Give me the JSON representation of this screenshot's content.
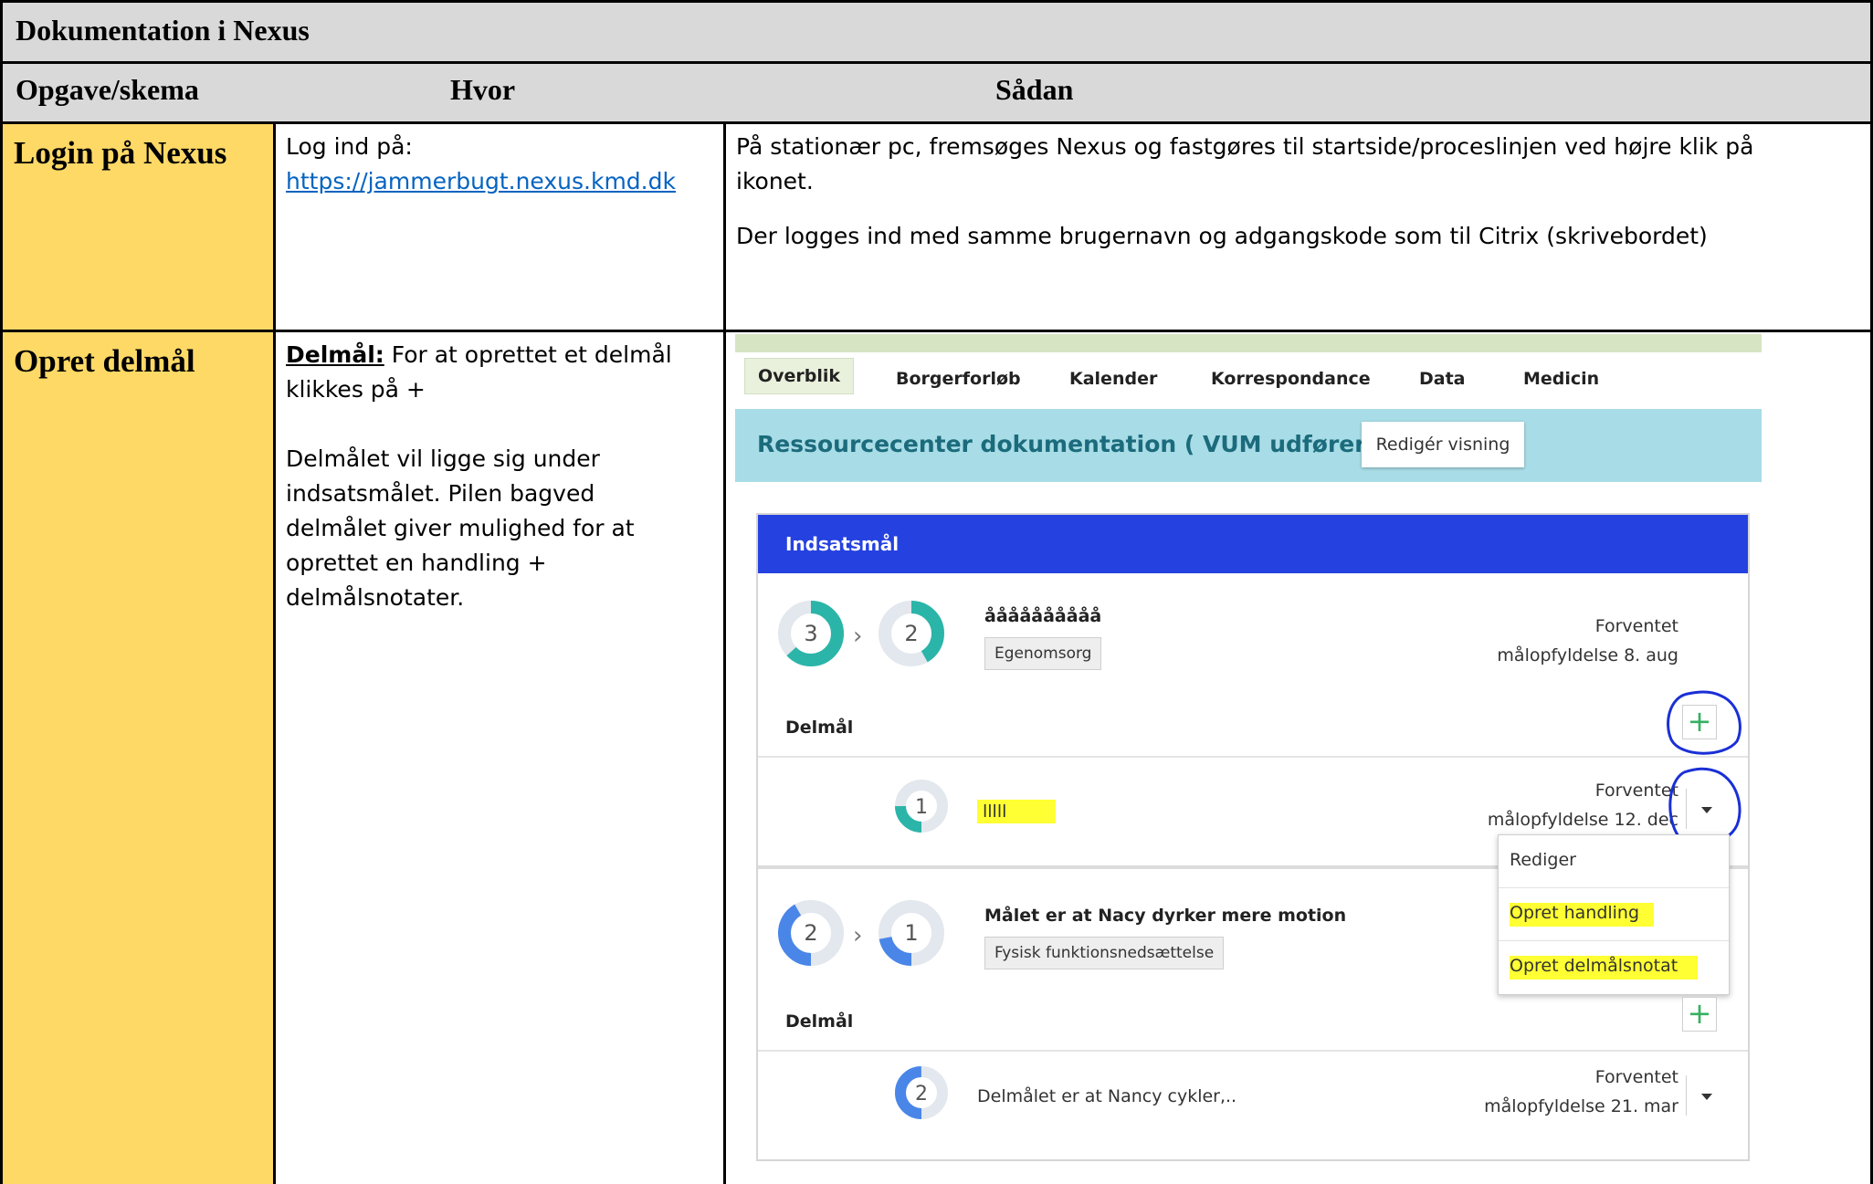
{
  "doc": {
    "title": "Dokumentation i Nexus",
    "headers": {
      "col1": "Opgave/skema",
      "col2": "Hvor",
      "col3": "Sådan"
    },
    "rows": [
      {
        "task": "Login på Nexus",
        "hvor_line1": "Log ind på:",
        "hvor_link": "https://jammerbugt.nexus.kmd.dk",
        "sadan_p1": "På stationær pc, fremsøges Nexus og fastgøres til startside/proceslinjen ved højre klik på ikonet.",
        "sadan_p2": "Der logges ind med samme brugernavn og adgangskode som til Citrix (skrivebordet)"
      },
      {
        "task": "Opret delmål",
        "hvor_label": "Delmål:",
        "hvor_p1_rest": " For at oprettet et delmål klikkes på +",
        "hvor_p2": "Delmålet vil ligge sig under indsatsmålet. Pilen bagved delmålet giver mulighed for at oprettet en handling + delmålsnotater."
      }
    ]
  },
  "nexus": {
    "tabs": [
      "Overblik",
      "Borgerforløb",
      "Kalender",
      "Korrespondance",
      "Data",
      "Medicin"
    ],
    "active_tab": "Overblik",
    "banner_title": "Ressourcecenter dokumentation ( VUM udfører)",
    "edit_view_button": "Redigér visning",
    "card_title": "Indsatsmål",
    "goal1": {
      "from": "3",
      "to": "2",
      "name": "åååååååååå",
      "tag": "Egenomsorg",
      "expected_l1": "Forventet",
      "expected_l2": "målopfyldelse 8. aug",
      "delmaal_label": "Delmål",
      "sub": {
        "level": "1",
        "name": "lllll",
        "expected_l1": "Forventet",
        "expected_l2": "målopfyldelse 12. dec"
      }
    },
    "menu": [
      "Rediger",
      "Opret handling",
      "Opret delmålsnotat"
    ],
    "goal2": {
      "from": "2",
      "to": "1",
      "name": "Målet er at Nacy dyrker mere motion",
      "tag": "Fysisk funktionsnedsættelse",
      "delmaal_label": "Delmål",
      "sub": {
        "level": "2",
        "name": "Delmålet er at Nancy cykler,..",
        "expected_l1": "Forventet",
        "expected_l2": "målopfyldelse 21. mar"
      }
    },
    "colors": {
      "teal": "#2bb5a8",
      "blue": "#4a86e8",
      "header_blue": "#2541e0",
      "highlight": "#ffff33",
      "annotation": "#1a2fd6"
    }
  }
}
